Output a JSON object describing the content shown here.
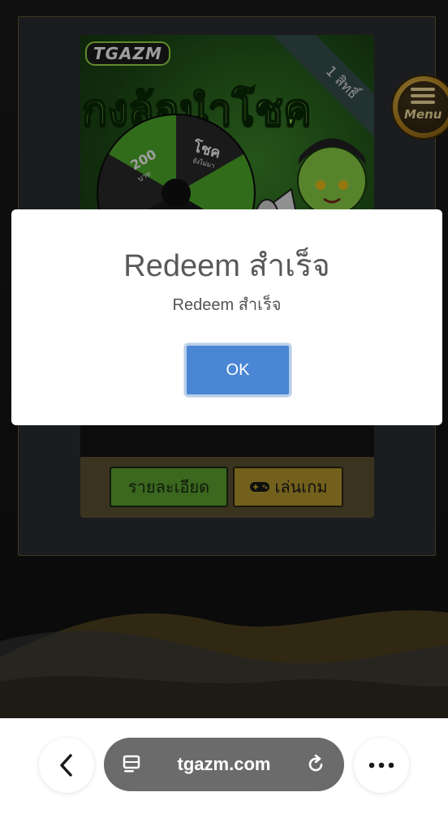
{
  "banner": {
    "logo_text": "TGAZM",
    "title_text": "กงล้อนำโชค",
    "ribbon_text": "1 สิทธิ์",
    "wheel_segment_amount": "200",
    "wheel_segment_unit": "บาท",
    "wheel_segment_luck": "โชค",
    "wheel_segment_luck_sub": "ยังไม่มา"
  },
  "promo": {
    "details_label": "รายละเอียด",
    "play_label": "เล่นเกม"
  },
  "menu": {
    "label": "Menu"
  },
  "modal": {
    "title": "Redeem สำเร็จ",
    "message": "Redeem สำเร็จ",
    "ok_label": "OK"
  },
  "browser": {
    "url": "tgazm.com"
  },
  "colors": {
    "accent_blue": "#4a86d4",
    "green_button": "#5fa732",
    "gold_button": "#b99b2e",
    "url_pill": "#6b6b6b"
  }
}
